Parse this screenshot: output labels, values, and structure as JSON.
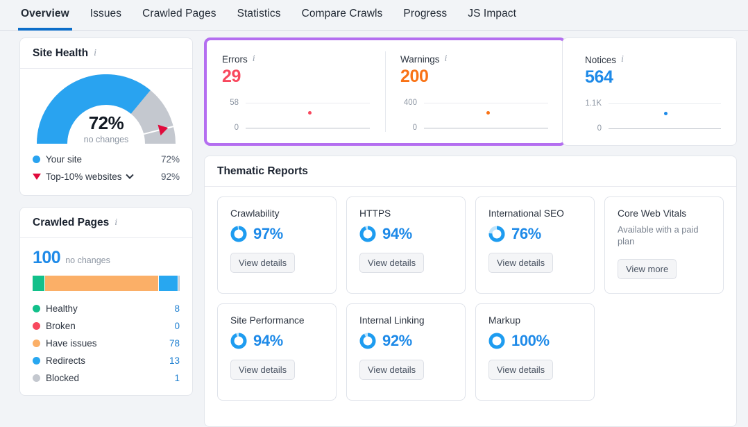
{
  "tabs": [
    {
      "label": "Overview",
      "active": true
    },
    {
      "label": "Issues",
      "active": false
    },
    {
      "label": "Crawled Pages",
      "active": false
    },
    {
      "label": "Statistics",
      "active": false
    },
    {
      "label": "Compare Crawls",
      "active": false
    },
    {
      "label": "Progress",
      "active": false
    },
    {
      "label": "JS Impact",
      "active": false
    }
  ],
  "site_health": {
    "title": "Site Health",
    "info_icon": "info-icon",
    "gauge_percent_label": "72%",
    "gauge_percent": 72,
    "gauge_change_note": "no changes",
    "benchmark_percent": 92,
    "legend": [
      {
        "label": "Your site",
        "value": "72%",
        "color": "#29a3f0",
        "marker": "dot"
      },
      {
        "label": "Top-10% websites",
        "value": "92%",
        "color": "#e00b3c",
        "marker": "triangle",
        "has_chevron": true
      }
    ],
    "arc_colors": {
      "filled": "#29a3f0",
      "remainder": "#c4c8cf",
      "marker": "#e00b3c"
    }
  },
  "crawled_pages": {
    "title": "Crawled Pages",
    "info_icon": "info-icon",
    "total": "100",
    "change_note": "no changes",
    "bar_segments": [
      {
        "label": "Healthy",
        "percent": 8,
        "color": "#12c08a"
      },
      {
        "label": "Have issues",
        "percent": 78,
        "color": "#fbaf67"
      },
      {
        "label": "Redirects",
        "percent": 13,
        "color": "#28a7f0"
      },
      {
        "label": "Blocked",
        "percent": 1,
        "color": "#c4c8cf"
      }
    ],
    "legend": [
      {
        "label": "Healthy",
        "value": "8",
        "color": "#12c08a"
      },
      {
        "label": "Broken",
        "value": "0",
        "color": "#f8485e"
      },
      {
        "label": "Have issues",
        "value": "78",
        "color": "#fbaf67"
      },
      {
        "label": "Redirects",
        "value": "13",
        "color": "#28a7f0"
      },
      {
        "label": "Blocked",
        "value": "1",
        "color": "#c4c8cf"
      }
    ]
  },
  "metrics": {
    "highlight_color": "#b46ef0",
    "items": [
      {
        "label": "Errors",
        "info_icon": "info-icon",
        "value": "29",
        "color": "#f8485e",
        "axis_top": "58",
        "axis_bottom": "0"
      },
      {
        "label": "Warnings",
        "info_icon": "info-icon",
        "value": "200",
        "color": "#f97316",
        "axis_top": "400",
        "axis_bottom": "0"
      },
      {
        "label": "Notices",
        "info_icon": "info-icon",
        "value": "564",
        "color": "#1e8ae8",
        "axis_top": "1.1K",
        "axis_bottom": "0"
      }
    ]
  },
  "thematic_reports": {
    "title": "Thematic Reports",
    "cards": [
      {
        "title": "Crawlability",
        "percent": "97%",
        "percent_value": 97,
        "note": "",
        "button": "View details"
      },
      {
        "title": "HTTPS",
        "percent": "94%",
        "percent_value": 94,
        "note": "",
        "button": "View details"
      },
      {
        "title": "International SEO",
        "percent": "76%",
        "percent_value": 76,
        "note": "",
        "button": "View details"
      },
      {
        "title": "Core Web Vitals",
        "percent": "",
        "percent_value": null,
        "note": "Available with a paid plan",
        "button": "View more"
      },
      {
        "title": "Site Performance",
        "percent": "94%",
        "percent_value": 94,
        "note": "",
        "button": "View details"
      },
      {
        "title": "Internal Linking",
        "percent": "92%",
        "percent_value": 92,
        "note": "",
        "button": "View details"
      },
      {
        "title": "Markup",
        "percent": "100%",
        "percent_value": 100,
        "note": "",
        "button": "View details"
      }
    ]
  },
  "chart_data": [
    {
      "type": "pie",
      "title": "Site Health",
      "categories": [
        "Your site",
        "Top-10% websites"
      ],
      "values": [
        72,
        92
      ],
      "annotations": [
        "72%",
        "no changes"
      ]
    },
    {
      "type": "bar",
      "title": "Crawled Pages",
      "categories": [
        "Healthy",
        "Broken",
        "Have issues",
        "Redirects",
        "Blocked"
      ],
      "values": [
        8,
        0,
        78,
        13,
        1
      ],
      "ylabel": "pages",
      "ylim": [
        0,
        100
      ]
    },
    {
      "type": "scatter",
      "title": "Errors",
      "values": [
        29
      ],
      "ylim": [
        0,
        58
      ],
      "ylabel": "Errors"
    },
    {
      "type": "scatter",
      "title": "Warnings",
      "values": [
        200
      ],
      "ylim": [
        0,
        400
      ],
      "ylabel": "Warnings"
    },
    {
      "type": "scatter",
      "title": "Notices",
      "values": [
        564
      ],
      "ylim": [
        0,
        1100
      ],
      "ylabel": "Notices"
    }
  ]
}
